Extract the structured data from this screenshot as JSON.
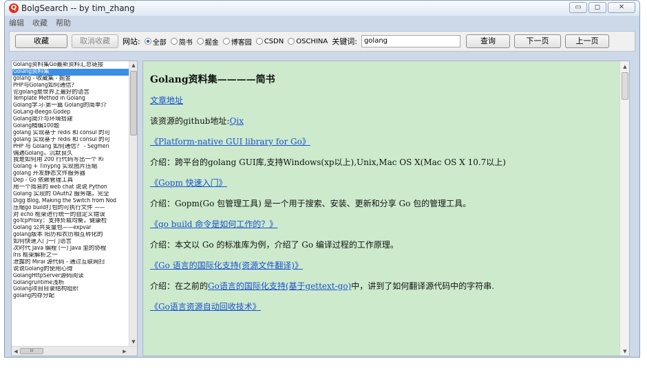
{
  "window": {
    "title": "BolgSearch -- by tim_zhang",
    "controls": [
      "▭",
      "◻",
      "✕"
    ]
  },
  "menu": [
    "编辑",
    "收藏",
    "帮助"
  ],
  "toolbar": {
    "fav_label": "收藏",
    "unfav_label": "取消收藏",
    "site_label": "网站:",
    "sites": [
      {
        "label": "全部",
        "selected": true
      },
      {
        "label": "简书",
        "selected": false
      },
      {
        "label": "掘金",
        "selected": false
      },
      {
        "label": "博客园",
        "selected": false
      },
      {
        "label": "CSDN",
        "selected": false
      },
      {
        "label": "OSCHINA",
        "selected": false
      }
    ],
    "keyword_label": "关键词:",
    "keyword_value": "golang",
    "query_label": "查询",
    "next_label": "下一页",
    "prev_label": "上一页"
  },
  "sidebar": {
    "selected_index": 1,
    "items": [
      "Golang资料集Go最新资料汇总链接",
      "Golang资料集",
      "golang - 收藏集 - 掘金",
      "PHP与Golang如何通信？",
      "论golang是世界上最好的语言",
      "Template Method in Golang",
      "Golang学习-第一篇 Golang的简单介",
      "GoLang-Beego.Godep",
      "Golang简介与环境搭建",
      "Golang精编100题",
      "golang 实现基于 redis 和 consul 的可",
      "golang 实现基于 redis 和 consul 的可",
      "PHP 与 Golang 如何通信？ - Segmen",
      "偶遇Golang，沉默良久",
      "我是如何用 200 行代码写出一个 Ri",
      "Golang + Tinypng 实现图片压缩",
      "golang 开发静态文件服务器",
      "Dep - Go 依赖管理工具",
      "用一个简易的 web chat 说说 Python",
      "Golang 实现的 OAuth2 服务端，完全",
      "Digg Blog, Making the Switch from Nod",
      "压缩go build打包的可执行文件 ——",
      "对 echo 框架进行统一的自定义错误",
      "goTcpProxy：支持负载均衡，健康检",
      "Golang 公共变量包——expvar",
      "golang版本 阳历和农历相互转化的",
      "如何快速入门一门语言",
      "次时代 Java 编程 (一) Java 里的协程",
      "Iris 框架解析之一",
      "泄露的 Mirai 源代码 - 通过互联网扫",
      "说说Golang的使用心得",
      "GolangHttpServer源码阅读",
      "Golangruntime浅析",
      "Golang项目目录结构组织",
      "golang内存分配"
    ],
    "hscroll_label": "III"
  },
  "article": {
    "title": "Golang资料集————简书",
    "link1": "文章地址",
    "github_prefix": "该资源的github地址:",
    "github_link": "Qix",
    "link2": "《Platform-native GUI library for Go》",
    "para2": "介绍：跨平台的golang GUI库,支持Windows(xp以上),Unix,Mac OS X(Mac OS X 10.7以上)",
    "link3": "《Gopm 快速入门》",
    "para3": "介绍：Gopm(Go 包管理工具) 是一个用于搜索、安装、更新和分享 Go 包的管理工具。",
    "link4": "《go build 命令是如何工作的？》",
    "para4": "介绍：本文以 Go 的标准库为例，介绍了 Go 编译过程的工作原理。",
    "link5": "《Go 语言的国际化支持(资源文件翻译)》",
    "para5_prefix": "介绍：在之前的",
    "para5_link": "Go语言的国际化支持(基于gettext-go)",
    "para5_suffix": "中，讲到了如何翻译源代码中的字符串.",
    "link6": "《Go语言资源自动回收技术》"
  }
}
